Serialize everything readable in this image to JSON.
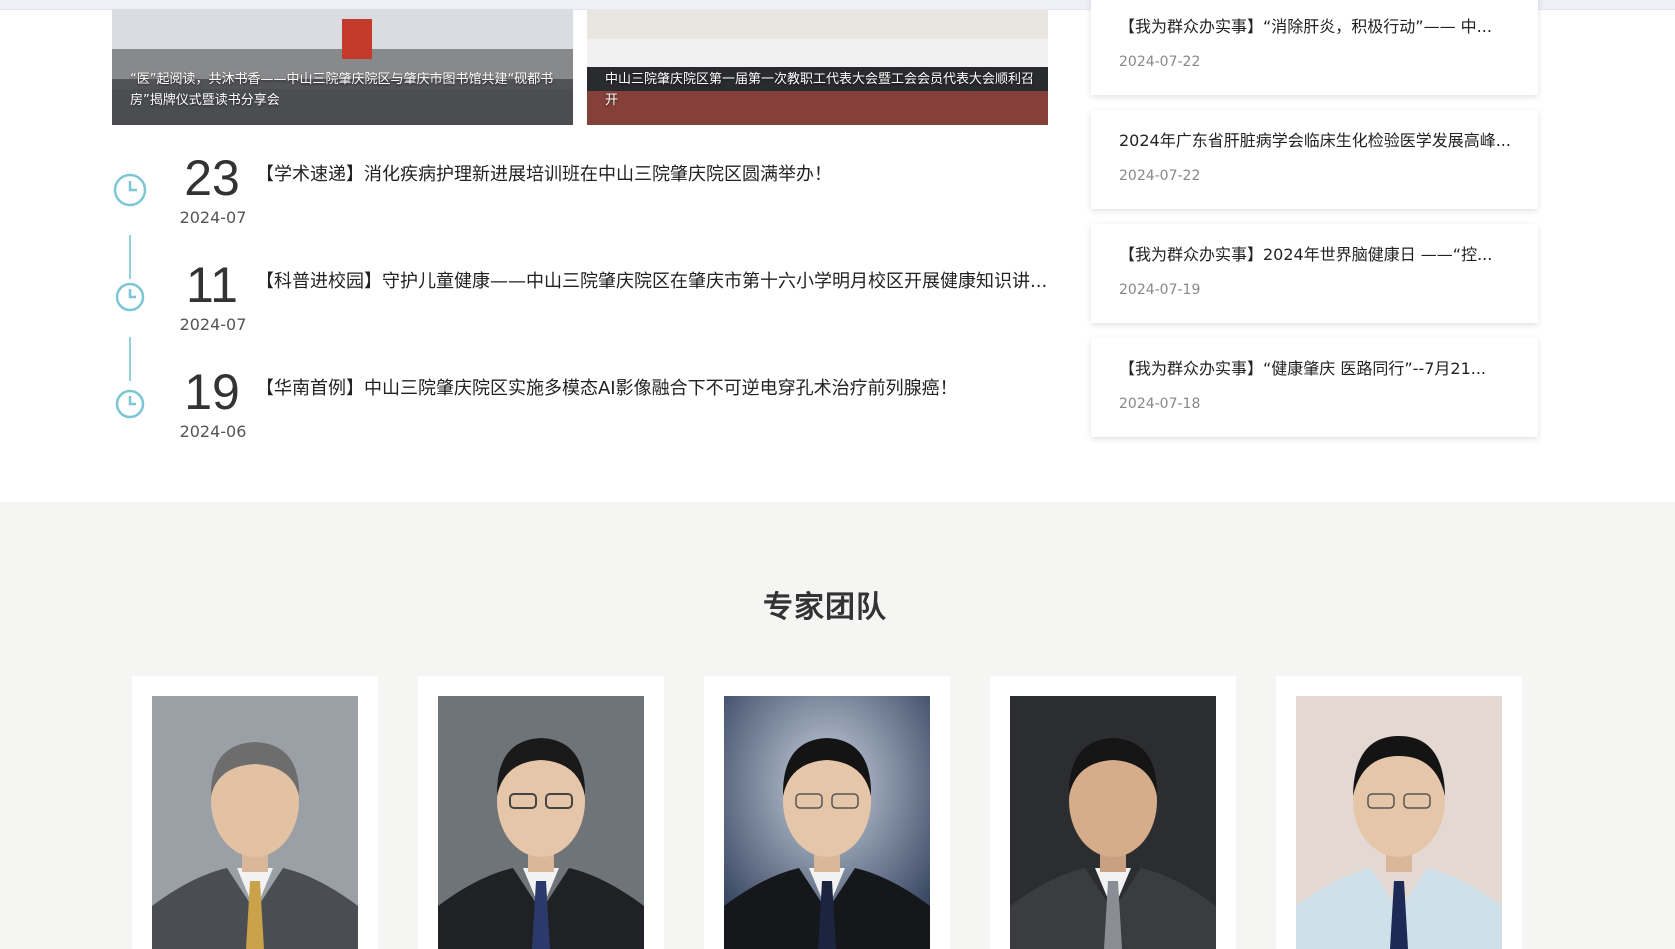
{
  "photos": [
    {
      "caption": "“医”起阅读，共沐书香——中山三院肇庆院区与肇庆市图书馆共建“砚都书房”揭牌仪式暨读书分享会"
    },
    {
      "caption": "中山三院肇庆院区第一届第一次教职工代表大会暨工会会员代表大会顺利召开"
    }
  ],
  "timeline": [
    {
      "day": "23",
      "ym": "2024-07",
      "title": "【学术速递】消化疾病护理新进展培训班在中山三院肇庆院区圆满举办！"
    },
    {
      "day": "11",
      "ym": "2024-07",
      "title": "【科普进校园】守护儿童健康——中山三院肇庆院区在肇庆市第十六小学明月校区开展健康知识讲..."
    },
    {
      "day": "19",
      "ym": "2024-06",
      "title": "【华南首例】中山三院肇庆院区实施多模态AI影像融合下不可逆电穿孔术治疗前列腺癌！"
    }
  ],
  "side_news": [
    {
      "title": "【我为群众办实事】“消除肝炎，积极行动”—— 中...",
      "date": "2024-07-22"
    },
    {
      "title": "2024年广东省肝脏病学会临床生化检验医学发展高峰...",
      "date": "2024-07-22"
    },
    {
      "title": "【我为群众办实事】2024年世界脑健康日 ——“控...",
      "date": "2024-07-19"
    },
    {
      "title": "【我为群众办实事】“健康肇庆 医路同行”--7月21...",
      "date": "2024-07-18"
    }
  ],
  "expert_section": {
    "title": "专家团队"
  },
  "experts": [
    {
      "bg": "#9aa0a6",
      "suit": "#4a4d52",
      "tie": "#c9a24a",
      "hair": "#6d6d6d"
    },
    {
      "bg": "#6f7479",
      "suit": "#1f2125",
      "tie": "#2b3a6b",
      "hair": "#1a1a1a"
    },
    {
      "bg": "#3e4f6e",
      "suit": "#15171b",
      "tie": "#1b2540",
      "hair": "#141414"
    },
    {
      "bg": "#2c2d30",
      "suit": "#3b3c40",
      "tie": "#8a8d94",
      "hair": "#151515"
    },
    {
      "bg": "#e3d8d2",
      "suit": "#cfe0ea",
      "tie": "#1c2a55",
      "hair": "#141414"
    }
  ],
  "colors": {
    "accent": "#7cc6d6",
    "text": "#222222",
    "date": "#888888",
    "section_bg": "#f5f6f4"
  }
}
